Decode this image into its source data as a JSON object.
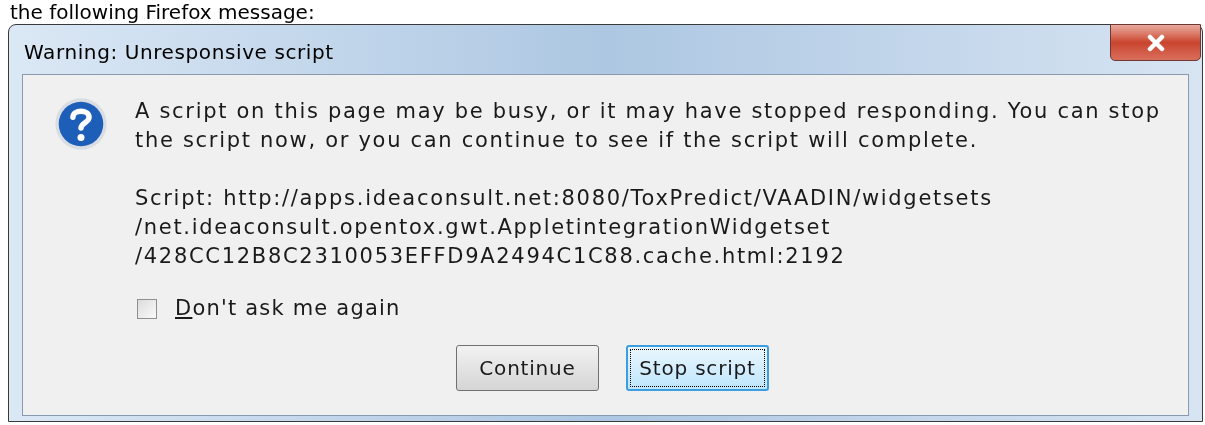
{
  "intro_text": "the following Firefox message:",
  "window": {
    "title": "Warning: Unresponsive script"
  },
  "message": "A script on this page may be busy, or it may have stopped responding. You can stop the script now, or you can continue to see if the script will complete.",
  "script_lines": [
    "Script: http://apps.ideaconsult.net:8080/ToxPredict/VAADIN/widgetsets",
    "/net.ideaconsult.opentox.gwt.AppletintegrationWidgetset",
    "/428CC12B8C2310053EFFD9A2494C1C88.cache.html:2192"
  ],
  "checkbox": {
    "label": "Don't ask me again",
    "checked": false
  },
  "buttons": [
    {
      "label": "Continue",
      "focused": false
    },
    {
      "label": "Stop script",
      "focused": true
    }
  ]
}
